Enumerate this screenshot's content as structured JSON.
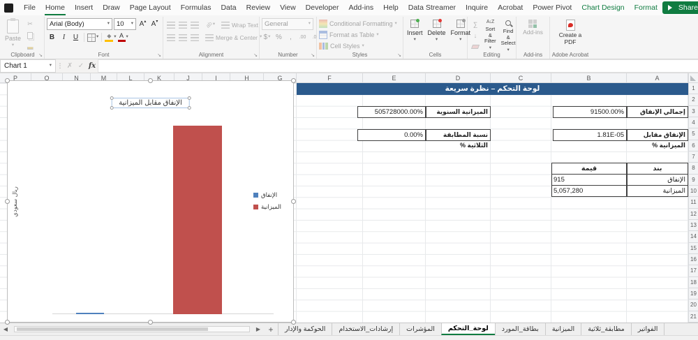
{
  "colors": {
    "excel_green": "#107C41",
    "banner_blue": "#2B5A8C"
  },
  "ribbon": {
    "tabs": [
      "File",
      "Home",
      "Insert",
      "Draw",
      "Page Layout",
      "Formulas",
      "Data",
      "Review",
      "View",
      "Developer",
      "Add-ins",
      "Help",
      "Data Streamer",
      "Inquire",
      "Acrobat",
      "Power Pivot",
      "Chart Design",
      "Format"
    ],
    "share_label": "Share",
    "groups": {
      "clipboard": {
        "paste": "Paste",
        "label": "Clipboard"
      },
      "font": {
        "name": "Arial (Body)",
        "size": "10",
        "bold": "B",
        "italic": "I",
        "underline": "U",
        "label": "Font"
      },
      "alignment": {
        "wrap_text": "Wrap Text",
        "merge_center": "Merge & Center",
        "label": "Alignment"
      },
      "number": {
        "format": "General",
        "currency": "$",
        "percent": "%",
        "comma": ",",
        "inc_decimal": ".00",
        "dec_decimal": ".0",
        "label": "Number"
      },
      "styles": {
        "conditional_formatting": "Conditional Formatting",
        "format_as_table": "Format as Table",
        "cell_styles": "Cell Styles",
        "label": "Styles"
      },
      "cells": {
        "insert": "Insert",
        "delete": "Delete",
        "format": "Format",
        "label": "Cells"
      },
      "editing": {
        "sort_filter": "Sort & Filter",
        "find_select": "Find & Select",
        "label": "Editing"
      },
      "addins": {
        "button": "Add-ins",
        "label": "Add-ins"
      },
      "acrobat": {
        "button": "Create a PDF",
        "label": "Adobe Acrobat"
      }
    }
  },
  "formula_bar": {
    "name_box": "Chart 1",
    "fx_label": "fx"
  },
  "grid": {
    "columns": [
      "P",
      "O",
      "N",
      "M",
      "L",
      "K",
      "J",
      "I",
      "H",
      "G",
      "F",
      "E",
      "D",
      "C",
      "B",
      "A"
    ],
    "rows": [
      "1",
      "2",
      "3",
      "4",
      "5",
      "6",
      "7",
      "8",
      "9",
      "10",
      "11",
      "12",
      "13",
      "14",
      "15",
      "16",
      "17",
      "18",
      "19",
      "20",
      "21"
    ]
  },
  "dashboard": {
    "banner": "لوحة التحكم – نظرة سريعة",
    "kpis": [
      {
        "label": "إجمالي الإنفاق",
        "value": "91500.00%"
      },
      {
        "label": "الميزانية السنوية",
        "value": "505728000.00%"
      },
      {
        "label": "الإنفاق مقابل الميزانية %",
        "value": "1.81E-05"
      },
      {
        "label": "نسبة المطابقة الثلاثية %",
        "value": "0.00%"
      }
    ],
    "table": {
      "headers": [
        "قيمة",
        "بند"
      ],
      "rows": [
        [
          "915",
          "الإنفاق"
        ],
        [
          "5,057,280",
          "الميزانية"
        ]
      ]
    }
  },
  "chart_data": {
    "type": "bar",
    "title": "الإنفاق مقابل الميزانية",
    "categories": [
      ""
    ],
    "series": [
      {
        "name": "الإنفاق",
        "values": [
          915
        ],
        "color": "#4F81BD"
      },
      {
        "name": "الميزانية",
        "values": [
          5057280
        ],
        "color": "#C0504D"
      }
    ],
    "xlabel": "",
    "ylabel": "ريال سعودي",
    "ylim": [
      0,
      5057280
    ],
    "legend_position": "right",
    "axis_tick_labels_visible": false,
    "grid": false
  },
  "sheet_tabs": [
    {
      "label": "الحوكمة والإدار",
      "active": false
    },
    {
      "label": "إرشادات_الاستخدام",
      "active": false
    },
    {
      "label": "المؤشرات",
      "active": false
    },
    {
      "label": "لوحة_التحكم",
      "active": true
    },
    {
      "label": "بطاقة_المورد",
      "active": false
    },
    {
      "label": "الميزانية",
      "active": false
    },
    {
      "label": "مطابقة_ثلاثية",
      "active": false
    },
    {
      "label": "الفواتير",
      "active": false
    }
  ],
  "new_sheet_label": "+"
}
